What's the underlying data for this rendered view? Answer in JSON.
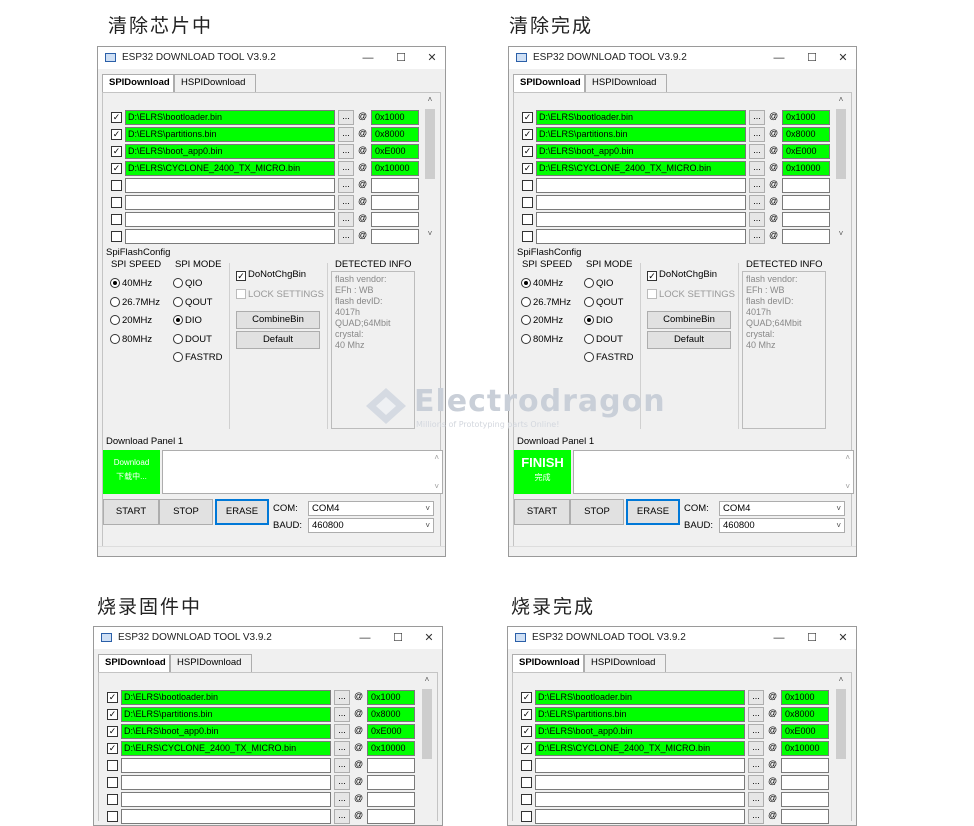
{
  "captions": [
    "清除芯片中",
    "清除完成",
    "烧录固件中",
    "烧录完成"
  ],
  "window": {
    "title": "ESP32 DOWNLOAD TOOL V3.9.2",
    "minimize": "—",
    "maximize": "☐",
    "close": "✕",
    "tabs": [
      "SPIDownload",
      "HSPIDownload"
    ]
  },
  "files": [
    {
      "checked": true,
      "path": "D:\\ELRS\\bootloader.bin",
      "addr": "0x1000"
    },
    {
      "checked": true,
      "path": "D:\\ELRS\\partitions.bin",
      "addr": "0x8000"
    },
    {
      "checked": true,
      "path": "D:\\ELRS\\boot_app0.bin",
      "addr": "0xE000"
    },
    {
      "checked": true,
      "path": "D:\\ELRS\\CYCLONE_2400_TX_MICRO.bin",
      "addr": "0x10000"
    },
    {
      "checked": false,
      "path": "",
      "addr": ""
    },
    {
      "checked": false,
      "path": "",
      "addr": ""
    },
    {
      "checked": false,
      "path": "",
      "addr": ""
    },
    {
      "checked": false,
      "path": "",
      "addr": ""
    }
  ],
  "file_controls": {
    "browse": "...",
    "at": "@"
  },
  "config": {
    "label": "SpiFlashConfig",
    "speed_label": "SPI SPEED",
    "speeds": [
      "40MHz",
      "26.7MHz",
      "20MHz",
      "80MHz"
    ],
    "speed_selected": "40MHz",
    "mode_label": "SPI MODE",
    "modes": [
      "QIO",
      "QOUT",
      "DIO",
      "DOUT",
      "FASTRD"
    ],
    "mode_selected": "DIO",
    "donotchg": "DoNotChgBin",
    "lock": "LOCK SETTINGS",
    "combine": "CombineBin",
    "default": "Default",
    "detected_label": "DETECTED INFO",
    "detected_text": "flash vendor:\nEFh : WB\nflash devID:\n4017h\nQUAD;64Mbit\ncrystal:\n40 Mhz"
  },
  "download": {
    "panel_label": "Download Panel 1",
    "start": "START",
    "stop": "STOP",
    "erase": "ERASE",
    "com_label": "COM:",
    "com_value": "COM4",
    "baud_label": "BAUD:",
    "baud_value": "460800",
    "status_downloading": [
      "Download",
      "下载中..."
    ],
    "status_finish": [
      "FINISH",
      "完成"
    ]
  },
  "watermark": {
    "brand": "Electrodragon",
    "tagline": "Millions of Prototyping parts Online!"
  },
  "colors": {
    "active_green": "#00ff00",
    "focus_blue": "#0078d7"
  }
}
